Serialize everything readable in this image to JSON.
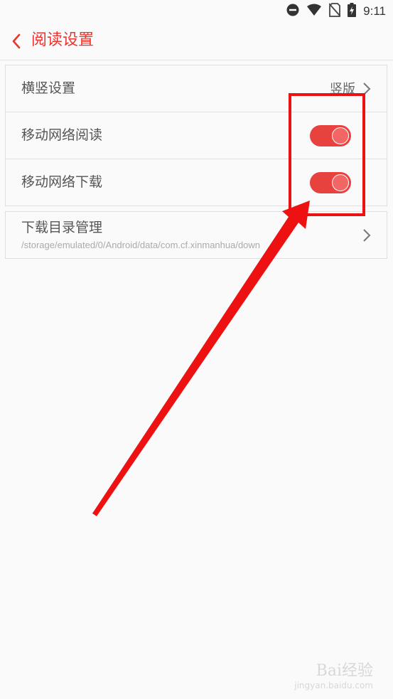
{
  "status_bar": {
    "time": "9:11"
  },
  "header": {
    "title": "阅读设置"
  },
  "settings": {
    "orientation": {
      "label": "横竖设置",
      "value": "竖版"
    },
    "mobile_read": {
      "label": "移动网络阅读",
      "enabled": true
    },
    "mobile_download": {
      "label": "移动网络下载",
      "enabled": true
    },
    "download_dir": {
      "label": "下载目录管理",
      "path": "/storage/emulated/0/Android/data/com.cf.xinmanhua/down"
    }
  },
  "watermark": {
    "brand": "Bai经验",
    "url": "jingyan.baidu.com"
  },
  "colors": {
    "accent": "#e8352f",
    "toggle_on": "#e8423f",
    "annotation": "#ee1111"
  }
}
